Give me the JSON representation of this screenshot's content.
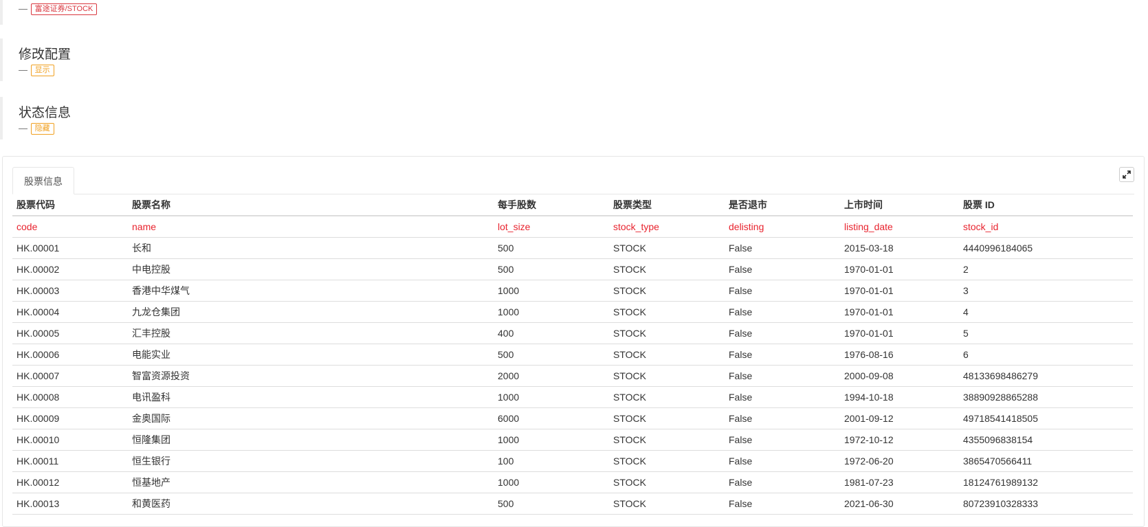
{
  "sections": {
    "top": {
      "badge": "富途证券/STOCK"
    },
    "config": {
      "title": "修改配置",
      "badge": "显示"
    },
    "status": {
      "title": "状态信息",
      "badge": "隐藏"
    }
  },
  "dash": "—",
  "tab": {
    "label": "股票信息"
  },
  "colors": {
    "field_name": "#e8232e",
    "badge_red": "#d9363e",
    "badge_orange": "#f0a020"
  },
  "table": {
    "headers": [
      "股票代码",
      "股票名称",
      "每手股数",
      "股票类型",
      "是否退市",
      "上市时间",
      "股票 ID"
    ],
    "fields": [
      "code",
      "name",
      "lot_size",
      "stock_type",
      "delisting",
      "listing_date",
      "stock_id"
    ],
    "rows": [
      [
        "HK.00001",
        "长和",
        "500",
        "STOCK",
        "False",
        "2015-03-18",
        "4440996184065"
      ],
      [
        "HK.00002",
        "中电控股",
        "500",
        "STOCK",
        "False",
        "1970-01-01",
        "2"
      ],
      [
        "HK.00003",
        "香港中华煤气",
        "1000",
        "STOCK",
        "False",
        "1970-01-01",
        "3"
      ],
      [
        "HK.00004",
        "九龙仓集团",
        "1000",
        "STOCK",
        "False",
        "1970-01-01",
        "4"
      ],
      [
        "HK.00005",
        "汇丰控股",
        "400",
        "STOCK",
        "False",
        "1970-01-01",
        "5"
      ],
      [
        "HK.00006",
        "电能实业",
        "500",
        "STOCK",
        "False",
        "1976-08-16",
        "6"
      ],
      [
        "HK.00007",
        "智富资源投资",
        "2000",
        "STOCK",
        "False",
        "2000-09-08",
        "48133698486279"
      ],
      [
        "HK.00008",
        "电讯盈科",
        "1000",
        "STOCK",
        "False",
        "1994-10-18",
        "38890928865288"
      ],
      [
        "HK.00009",
        "金奥国际",
        "6000",
        "STOCK",
        "False",
        "2001-09-12",
        "49718541418505"
      ],
      [
        "HK.00010",
        "恒隆集团",
        "1000",
        "STOCK",
        "False",
        "1972-10-12",
        "4355096838154"
      ],
      [
        "HK.00011",
        "恒生银行",
        "100",
        "STOCK",
        "False",
        "1972-06-20",
        "3865470566411"
      ],
      [
        "HK.00012",
        "恒基地产",
        "1000",
        "STOCK",
        "False",
        "1981-07-23",
        "18124761989132"
      ],
      [
        "HK.00013",
        "和黄医药",
        "500",
        "STOCK",
        "False",
        "2021-06-30",
        "80723910328333"
      ]
    ]
  }
}
